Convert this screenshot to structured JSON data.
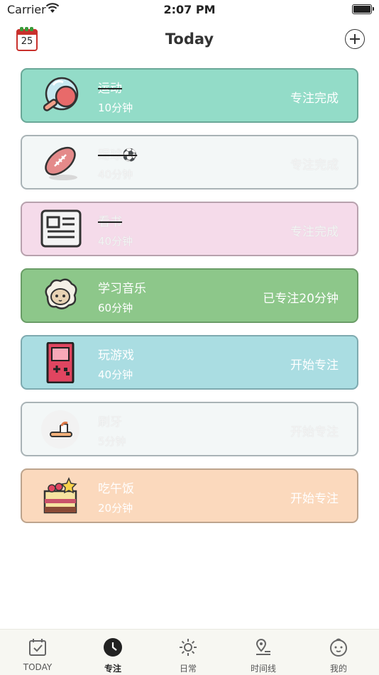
{
  "status_bar": {
    "carrier": "Carrier",
    "time": "2:07 PM"
  },
  "nav": {
    "title": "Today",
    "calendar_day": "25",
    "left_icon": "calendar-icon",
    "right_icon": "add-icon"
  },
  "tasks": [
    {
      "name": "运动",
      "duration": "10分钟",
      "action": "专注完成",
      "bg": "#93dcc8",
      "border": "#6aa898",
      "icon": "ping-pong-icon",
      "done": true,
      "light": false
    },
    {
      "name": "踢球⚽",
      "duration": "40分钟",
      "action": "专注完成",
      "bg": "#f3f7f7",
      "border": "#a9b3b6",
      "icon": "football-icon",
      "done": true,
      "light": true
    },
    {
      "name": "看书",
      "duration": "40分钟",
      "action": "专注完成",
      "bg": "#f5dbea",
      "border": "#b7a1ad",
      "icon": "newspaper-icon",
      "done": true,
      "light": true
    },
    {
      "name": "学习音乐",
      "duration": "60分钟",
      "action": "已专注20分钟",
      "bg": "#8dc78a",
      "border": "#6a9d67",
      "icon": "sheep-icon",
      "done": false,
      "light": false
    },
    {
      "name": "玩游戏",
      "duration": "40分钟",
      "action": "开始专注",
      "bg": "#aadde2",
      "border": "#7eaab0",
      "icon": "game-console-icon",
      "done": false,
      "light": false
    },
    {
      "name": "刷牙",
      "duration": "5分钟",
      "action": "开始专注",
      "bg": "#f3f7f7",
      "border": "#a9b3b6",
      "icon": "toothbrush-icon",
      "done": false,
      "light": true
    },
    {
      "name": "吃午饭",
      "duration": "20分钟",
      "action": "开始专注",
      "bg": "#fbd9bd",
      "border": "#bda48d",
      "icon": "cake-icon",
      "done": false,
      "light": false
    }
  ],
  "tabs": [
    {
      "label": "TODAY",
      "icon": "calendar-check-icon",
      "active": false
    },
    {
      "label": "专注",
      "icon": "clock-icon",
      "active": true
    },
    {
      "label": "日常",
      "icon": "sun-icon",
      "active": false
    },
    {
      "label": "时间线",
      "icon": "map-pin-icon",
      "active": false
    },
    {
      "label": "我的",
      "icon": "face-icon",
      "active": false
    }
  ]
}
